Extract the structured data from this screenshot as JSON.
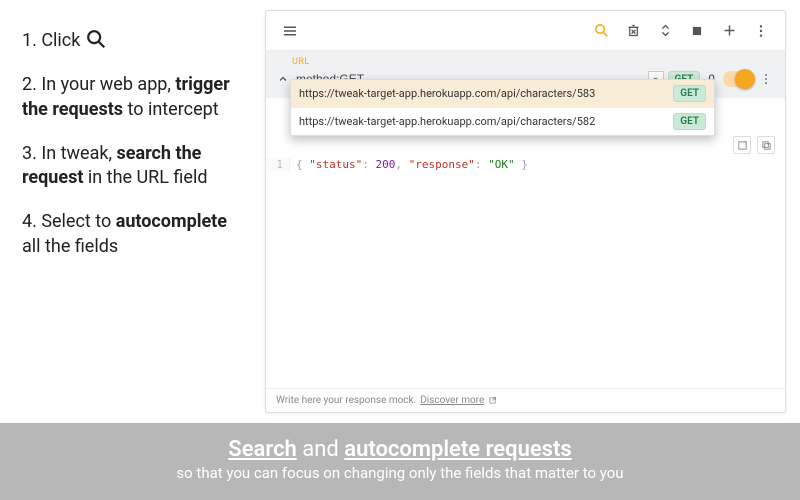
{
  "instructions": {
    "step1_prefix": "1. Click ",
    "step2_prefix": "2. In your web app, ",
    "step2_bold": "trigger the requests",
    "step2_suffix": " to intercept",
    "step3_prefix": "3. In tweak, ",
    "step3_bold": "search the request",
    "step3_suffix": " in the URL field",
    "step4_prefix": "4. Select to ",
    "step4_bold": "autocomplete",
    "step4_suffix": " all the fields"
  },
  "panel": {
    "url_label": "URL",
    "url_value": "method:GET",
    "method_badge": "GET",
    "delay": "0",
    "suggestions": [
      {
        "url": "https://tweak-target-app.herokuapp.com/api/characters/583",
        "method": "GET"
      },
      {
        "url": "https://tweak-target-app.herokuapp.com/api/characters/582",
        "method": "GET"
      }
    ],
    "code": {
      "line_no": "1",
      "status_key": "\"status\"",
      "status_val": "200",
      "response_key": "\"response\"",
      "response_val": "\"OK\""
    },
    "footer_text": "Write here your response mock.",
    "footer_link": "Discover more"
  },
  "banner": {
    "w1": "Search",
    "mid": " and ",
    "w2": "autocomplete requests",
    "sub": "so that you can focus on changing only the fields that matter to you"
  }
}
